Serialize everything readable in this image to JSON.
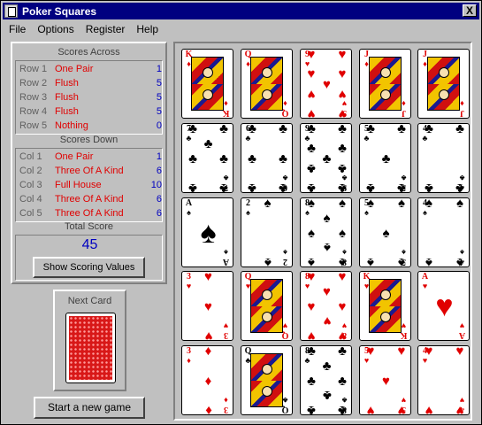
{
  "window": {
    "title": "Poker Squares",
    "close_glyph": "X"
  },
  "menu": [
    {
      "label": "File"
    },
    {
      "label": "Options"
    },
    {
      "label": "Register"
    },
    {
      "label": "Help"
    }
  ],
  "scores_across": {
    "title": "Scores Across",
    "rows": [
      {
        "label": "Row 1",
        "hand": "One Pair",
        "points": "1"
      },
      {
        "label": "Row 2",
        "hand": "Flush",
        "points": "5"
      },
      {
        "label": "Row 3",
        "hand": "Flush",
        "points": "5"
      },
      {
        "label": "Row 4",
        "hand": "Flush",
        "points": "5"
      },
      {
        "label": "Row 5",
        "hand": "Nothing",
        "points": "0"
      }
    ]
  },
  "scores_down": {
    "title": "Scores Down",
    "rows": [
      {
        "label": "Col 1",
        "hand": "One Pair",
        "points": "1"
      },
      {
        "label": "Col 2",
        "hand": "Three Of A Kind",
        "points": "6"
      },
      {
        "label": "Col 3",
        "hand": "Full House",
        "points": "10"
      },
      {
        "label": "Col 4",
        "hand": "Three Of A Kind",
        "points": "6"
      },
      {
        "label": "Col 5",
        "hand": "Three Of A Kind",
        "points": "6"
      }
    ]
  },
  "total": {
    "title": "Total Score",
    "value": "45"
  },
  "buttons": {
    "show_scoring": "Show Scoring Values",
    "new_game": "Start a new game"
  },
  "next_card": {
    "title": "Next Card"
  },
  "grid": [
    [
      {
        "rank": "K",
        "suit": "♦"
      },
      {
        "rank": "Q",
        "suit": "♦"
      },
      {
        "rank": "9",
        "suit": "♥"
      },
      {
        "rank": "J",
        "suit": "♦"
      },
      {
        "rank": "J",
        "suit": "♦"
      }
    ],
    [
      {
        "rank": "7",
        "suit": "♣"
      },
      {
        "rank": "6",
        "suit": "♣"
      },
      {
        "rank": "9",
        "suit": "♣"
      },
      {
        "rank": "5",
        "suit": "♣"
      },
      {
        "rank": "4",
        "suit": "♣"
      }
    ],
    [
      {
        "rank": "A",
        "suit": "♠"
      },
      {
        "rank": "2",
        "suit": "♠"
      },
      {
        "rank": "8",
        "suit": "♠"
      },
      {
        "rank": "5",
        "suit": "♠"
      },
      {
        "rank": "4",
        "suit": "♠"
      }
    ],
    [
      {
        "rank": "3",
        "suit": "♥"
      },
      {
        "rank": "Q",
        "suit": "♥"
      },
      {
        "rank": "8",
        "suit": "♥"
      },
      {
        "rank": "K",
        "suit": "♥"
      },
      {
        "rank": "A",
        "suit": "♥"
      }
    ],
    [
      {
        "rank": "3",
        "suit": "♦"
      },
      {
        "rank": "Q",
        "suit": "♣"
      },
      {
        "rank": "8",
        "suit": "♣"
      },
      {
        "rank": "5",
        "suit": "♥"
      },
      {
        "rank": "4",
        "suit": "♥"
      }
    ]
  ]
}
